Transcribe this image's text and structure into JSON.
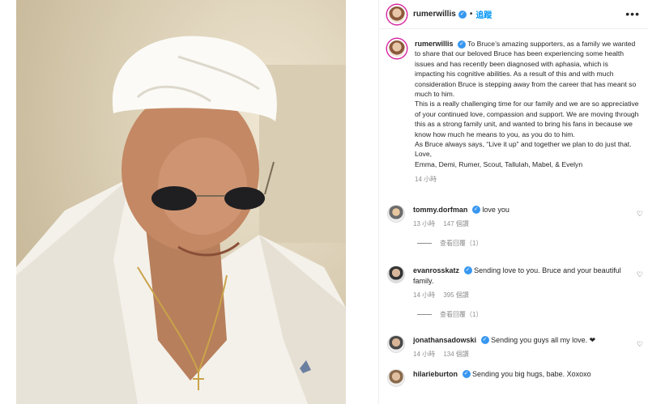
{
  "post": {
    "username": "rumerwillis",
    "follow_label": "追蹤",
    "more_label": "•••",
    "caption": {
      "username": "rumerwillis",
      "lines": [
        "To Bruce’s amazing supporters, as a family we wanted to share that our beloved Bruce has been experiencing some health issues and has recently been diagnosed with aphasia, which is impacting his cognitive abilities. As a result of this and with much consideration Bruce is stepping away from the career that has meant so much to him.",
        "This is a really challenging time for our family and we are so appreciative of your continued love, compassion and support. We are moving through this as a strong family unit, and wanted to bring his fans in because we know how much he means to you, as you do to him.",
        "As Bruce always says, “Live it up” and together we plan to do just that.",
        "Love,",
        "Emma, Demi, Rumer, Scout, Tallulah, Mabel, & Evelyn"
      ],
      "time": "14 小時"
    },
    "comments": [
      {
        "username": "tommy.dorfman",
        "text": "love you",
        "time": "13 小時",
        "likes": "147 個讚",
        "replies": "查看回覆（1）"
      },
      {
        "username": "evanrosskatz",
        "text": "Sending love to you. Bruce and your beautiful family.",
        "time": "14 小時",
        "likes": "395 個讚",
        "replies": "查看回覆（1）"
      },
      {
        "username": "jonathansadowski",
        "text": "Sending you guys all my love. ❤",
        "time": "14 小時",
        "likes": "134 個讚"
      },
      {
        "username": "hilarieburton",
        "text": "Sending you big hugs, babe. Xoxoxo"
      }
    ]
  },
  "colors": {
    "accent": "#0095f6",
    "verified": "#3897f0",
    "muted": "#8e8e8e"
  },
  "icons": {
    "verified": "verified-badge-icon",
    "like": "heart-outline-icon",
    "more": "more-options-icon"
  }
}
